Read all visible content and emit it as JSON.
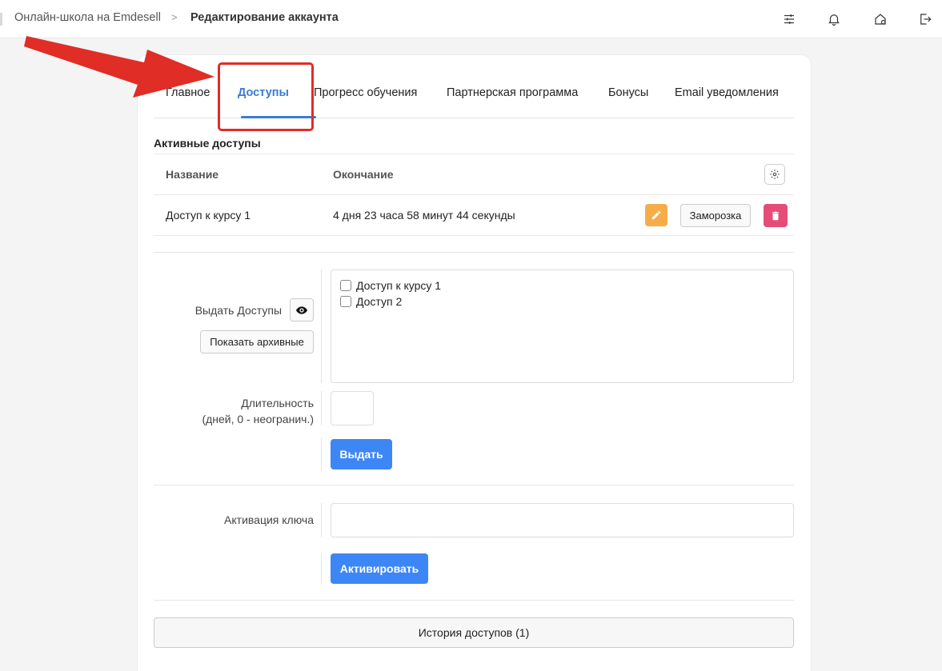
{
  "breadcrumb": {
    "school": "Онлайн-школа на Emdesell",
    "separator": ">",
    "current": "Редактирование аккаунта"
  },
  "topbar_icons": [
    "sliders-icon",
    "bell-icon",
    "home-settings-icon",
    "logout-icon"
  ],
  "tabs": [
    {
      "label": "Главное",
      "active": false
    },
    {
      "label": "Доступы",
      "active": true
    },
    {
      "label": "Прогресс обучения",
      "active": false
    },
    {
      "label": "Партнерская программа",
      "active": false
    },
    {
      "label": "Бонусы",
      "active": false
    },
    {
      "label": "Email уведомления",
      "active": false
    }
  ],
  "active_access": {
    "title": "Активные доступы",
    "columns": [
      "Название",
      "Окончание"
    ],
    "rows": [
      {
        "name": "Доступ к курсу 1",
        "ends": "4 дня 23 часа 58 минут 44 секунды",
        "freeze_label": "Заморозка"
      }
    ]
  },
  "grant": {
    "label": "Выдать Доступы",
    "show_archived": "Показать архивные",
    "options": [
      "Доступ к курсу 1",
      "Доступ 2"
    ],
    "duration_label_line1": "Длительность",
    "duration_label_line2": "(дней, 0 - неогранич.)",
    "duration_value": "",
    "submit": "Выдать"
  },
  "activation": {
    "label": "Активация ключа",
    "value": "",
    "submit": "Активировать"
  },
  "history_button": "История доступов (1)",
  "colors": {
    "accent": "#3a7bd5",
    "primary_button": "#3d86f5",
    "edit_button": "#f6ad49",
    "delete_button": "#e54d76",
    "annotation": "#e02d26"
  }
}
